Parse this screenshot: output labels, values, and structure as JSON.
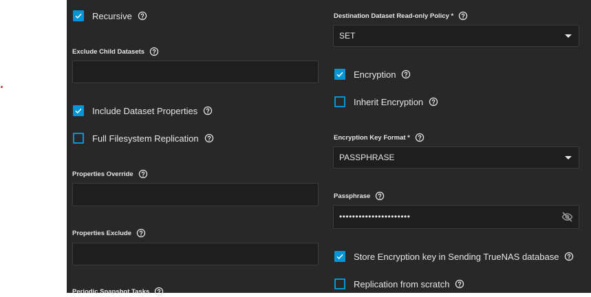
{
  "left": {
    "recursive": {
      "label": "Recursive",
      "checked": true
    },
    "exclude_child_datasets": {
      "label": "Exclude Child Datasets",
      "value": ""
    },
    "include_dataset_properties": {
      "label": "Include Dataset Properties",
      "checked": true
    },
    "full_filesystem_replication": {
      "label": "Full Filesystem Replication",
      "checked": false
    },
    "properties_override": {
      "label": "Properties Override",
      "value": ""
    },
    "properties_exclude": {
      "label": "Properties Exclude",
      "value": ""
    },
    "periodic_snapshot_tasks": {
      "label": "Periodic Snapshot Tasks"
    }
  },
  "right": {
    "readonly_policy": {
      "label": "Destination Dataset Read-only Policy *",
      "value": "SET"
    },
    "encryption": {
      "label": "Encryption",
      "checked": true
    },
    "inherit_encryption": {
      "label": "Inherit Encryption",
      "checked": false
    },
    "key_format": {
      "label": "Encryption Key Format *",
      "value": "PASSPHRASE"
    },
    "passphrase": {
      "label": "Passphrase",
      "value": "••••••••••••••••••••••"
    },
    "store_key": {
      "label": "Store Encryption key in Sending TrueNAS database",
      "checked": true
    },
    "replication_from_scratch": {
      "label": "Replication from scratch",
      "checked": false
    }
  },
  "colors": {
    "accent": "#0095d5",
    "panel_bg": "#282828",
    "input_bg": "#1e1e1e",
    "text": "#e6e6e6"
  },
  "icons": {
    "help": "help-circle-icon",
    "check": "check-icon",
    "visibility_off": "eye-off-icon",
    "dropdown": "caret-down-icon"
  }
}
